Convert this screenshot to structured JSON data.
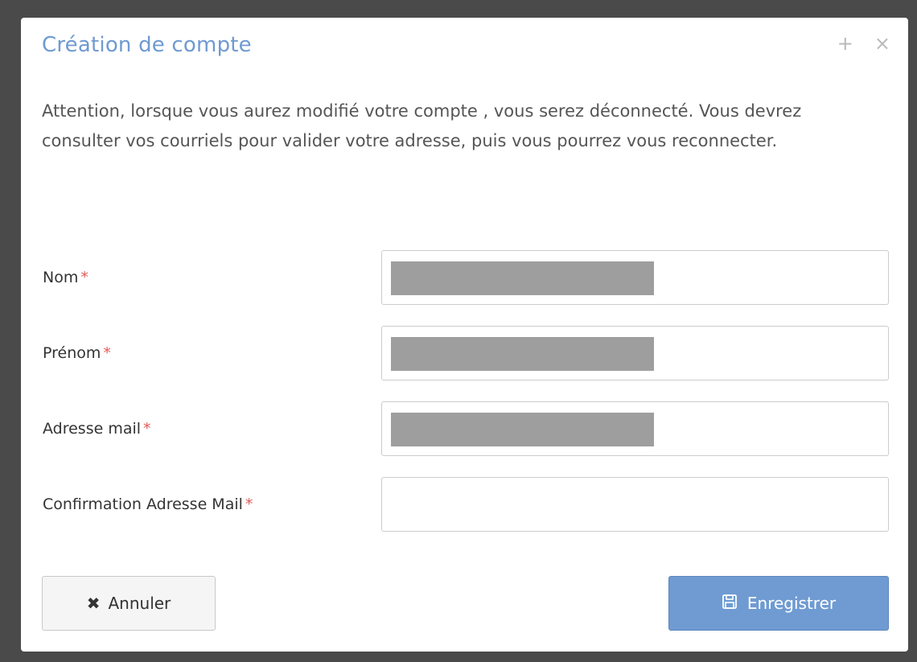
{
  "dialog": {
    "title": "Création de compte",
    "icons": [
      "plus-icon",
      "close-icon"
    ],
    "plus_glyph": "+",
    "close_glyph": "×"
  },
  "message": "Attention, lorsque vous aurez modifié votre compte , vous serez déconnecté. Vous devrez consulter vos courriels pour valider votre adresse, puis vous pourrez vous reconnecter.",
  "fields": {
    "nom": {
      "label": "Nom",
      "required_mark": "*",
      "value": ""
    },
    "prenom": {
      "label": "Prénom",
      "required_mark": "*",
      "value": ""
    },
    "email": {
      "label": "Adresse mail",
      "required_mark": "*",
      "value": ""
    },
    "email_confirm": {
      "label": "Confirmation Adresse Mail",
      "required_mark": "*",
      "value": ""
    }
  },
  "buttons": {
    "cancel_label": "Annuler",
    "cancel_icon": "times-icon",
    "save_label": "Enregistrer",
    "save_icon": "floppy-disk-icon"
  },
  "colors": {
    "title": "#6f9ad1",
    "required": "#e05a5a",
    "primary_button": "#6f9bd2",
    "overlay": "#4a4a4a"
  }
}
